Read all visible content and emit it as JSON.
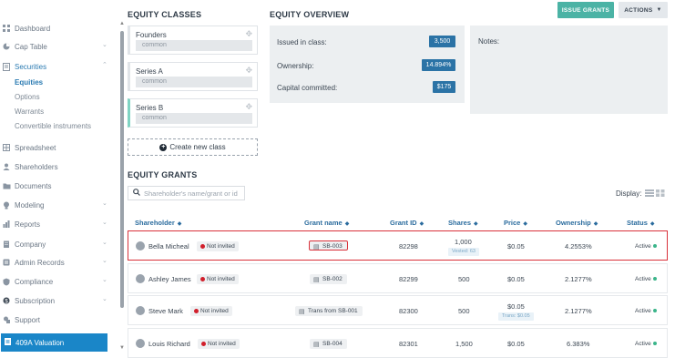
{
  "sidebar": {
    "items": [
      {
        "label": "Dashboard",
        "icon": "dashboard-icon"
      },
      {
        "label": "Cap Table",
        "icon": "pie-chart-icon"
      },
      {
        "label": "Securities",
        "icon": "document-icon"
      },
      {
        "label": "Spreadsheet",
        "icon": "spreadsheet-icon"
      },
      {
        "label": "Shareholders",
        "icon": "person-icon"
      },
      {
        "label": "Documents",
        "icon": "folder-icon"
      },
      {
        "label": "Modeling",
        "icon": "bulb-icon"
      },
      {
        "label": "Reports",
        "icon": "report-icon"
      },
      {
        "label": "Company",
        "icon": "building-icon"
      },
      {
        "label": "Admin Records",
        "icon": "records-icon"
      },
      {
        "label": "Compliance",
        "icon": "shield-icon"
      },
      {
        "label": "Subscription",
        "icon": "subscription-icon"
      },
      {
        "label": "Support",
        "icon": "support-icon"
      }
    ],
    "securities_sub": [
      "Equities",
      "Options",
      "Warrants",
      "Convertible instruments"
    ],
    "valuation": "409A Valuation"
  },
  "equity_classes": {
    "title": "EQUITY CLASSES",
    "classes": [
      {
        "name": "Founders",
        "type": "common"
      },
      {
        "name": "Series A",
        "type": "common"
      },
      {
        "name": "Series B",
        "type": "common"
      }
    ],
    "create_label": "Create new class"
  },
  "overview": {
    "title": "EQUITY OVERVIEW",
    "issued_label": "Issued in class:",
    "issued_value": "3,500",
    "ownership_label": "Ownership:",
    "ownership_value": "14.894%",
    "capital_label": "Capital committed:",
    "capital_value": "$175",
    "notes_label": "Notes:"
  },
  "header_buttons": {
    "issue": "ISSUE GRANTS",
    "actions": "ACTIONS"
  },
  "grants": {
    "title": "EQUITY GRANTS",
    "search_placeholder": "Shareholder's name/grant or id",
    "display_label": "Display:",
    "columns": [
      "Shareholder",
      "Grant name",
      "Grant ID",
      "Shares",
      "Price",
      "Ownership",
      "Status"
    ],
    "rows": [
      {
        "shareholder": "Bella Micheal",
        "invite": "Not invited",
        "grant": "SB-003",
        "grant_id": "82298",
        "shares": "1,000",
        "shares_sub": "Vested: 63",
        "price": "$0.05",
        "price_sub": "",
        "ownership": "4.2553%",
        "status": "Active"
      },
      {
        "shareholder": "Ashley James",
        "invite": "Not invited",
        "grant": "SB-002",
        "grant_id": "82299",
        "shares": "500",
        "shares_sub": "",
        "price": "$0.05",
        "price_sub": "",
        "ownership": "2.1277%",
        "status": "Active"
      },
      {
        "shareholder": "Steve Mark",
        "invite": "Not invited",
        "grant": "Trans from SB-001",
        "grant_id": "82300",
        "shares": "500",
        "shares_sub": "",
        "price": "$0.05",
        "price_sub": "Trans: $0.05",
        "ownership": "2.1277%",
        "status": "Active"
      },
      {
        "shareholder": "Louis Richard",
        "invite": "Not invited",
        "grant": "SB-004",
        "grant_id": "82301",
        "shares": "1,500",
        "shares_sub": "",
        "price": "$0.05",
        "price_sub": "",
        "ownership": "6.383%",
        "status": "Active"
      }
    ]
  },
  "colors": {
    "accent": "#1a86c8",
    "issue_button": "#4bb3a5",
    "highlight": "#d9313a",
    "badge": "#2b73a6"
  }
}
